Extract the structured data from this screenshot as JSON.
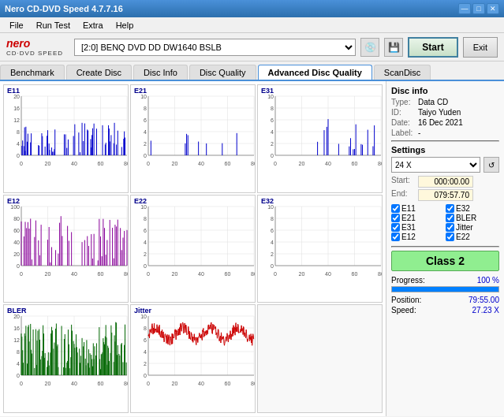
{
  "titleBar": {
    "title": "Nero CD-DVD Speed 4.7.7.16",
    "controls": [
      "—",
      "□",
      "✕"
    ]
  },
  "menuBar": {
    "items": [
      "File",
      "Run Test",
      "Extra",
      "Help"
    ]
  },
  "toolbar": {
    "logo": "nero",
    "logoSub": "CD·DVD SPEED",
    "drive": "[2:0]  BENQ DVD DD DW1640 BSLB",
    "startLabel": "Start",
    "exitLabel": "Exit"
  },
  "tabs": {
    "items": [
      "Benchmark",
      "Create Disc",
      "Disc Info",
      "Disc Quality",
      "Advanced Disc Quality",
      "ScanDisc"
    ],
    "activeIndex": 4
  },
  "discInfo": {
    "sectionTitle": "Disc info",
    "typeLabel": "Type:",
    "typeValue": "Data CD",
    "idLabel": "ID:",
    "idValue": "Taiyo Yuden",
    "dateLabel": "Date:",
    "dateValue": "16 Dec 2021",
    "labelLabel": "Label:",
    "labelValue": "-"
  },
  "settings": {
    "sectionTitle": "Settings",
    "speed": "24 X",
    "startLabel": "Start:",
    "startValue": "000:00.00",
    "endLabel": "End:",
    "endValue": "079:57.70",
    "checkboxes": [
      "E11",
      "E32",
      "E21",
      "BLER",
      "E31",
      "Jitter",
      "E12",
      "E22"
    ],
    "checkboxStates": [
      true,
      true,
      true,
      true,
      true,
      true,
      true,
      true
    ]
  },
  "classInfo": {
    "label": "Class 2",
    "progressLabel": "Progress:",
    "progressValue": "100 %",
    "progressPct": 100,
    "positionLabel": "Position:",
    "positionValue": "79:55.00",
    "speedLabel": "Speed:",
    "speedValue": "27.23 X"
  },
  "charts": [
    {
      "id": "E11",
      "label": "E11",
      "yMax": 20,
      "color": "#0000ff"
    },
    {
      "id": "E21",
      "label": "E21",
      "yMax": 10,
      "color": "#0000ff"
    },
    {
      "id": "E31",
      "label": "E31",
      "yMax": 10,
      "color": "#0000ff"
    },
    {
      "id": "E12",
      "label": "E12",
      "yMax": 100,
      "color": "#8800aa"
    },
    {
      "id": "E22",
      "label": "E22",
      "yMax": 10,
      "color": "#8800aa"
    },
    {
      "id": "E32",
      "label": "E32",
      "yMax": 10,
      "color": "#8800aa"
    },
    {
      "id": "BLER",
      "label": "BLER",
      "yMax": 20,
      "color": "#008800"
    },
    {
      "id": "Jitter",
      "label": "Jitter",
      "yMax": 10,
      "color": "#cc0000"
    }
  ]
}
